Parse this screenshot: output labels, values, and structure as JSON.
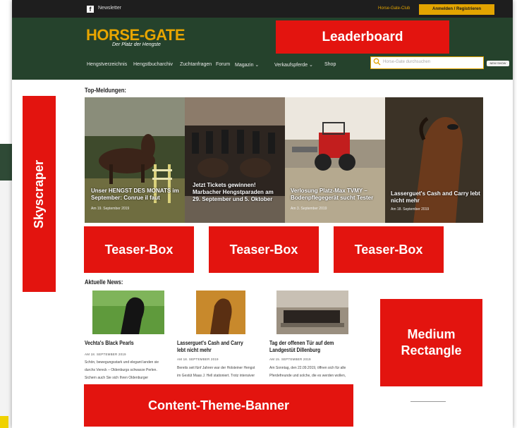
{
  "site": {
    "topbar": {
      "newsletter": "Newsletter",
      "club": "Horse-Gate-Club",
      "login": "Anmelden / Registrieren"
    },
    "logo": "HORSE-GATE",
    "tagline": "Der Platz der Hengste",
    "nav": [
      "Hengstverzeichnis",
      "Hengstbucharchiv",
      "Zuchtanfragen",
      "Forum",
      "Magazin ⌄",
      "Verkaufspferde ⌄",
      "Shop"
    ],
    "search_placeholder": "Horse-Gate durchsuchen",
    "search_button": "NEW SHOW"
  },
  "top_meldungen": {
    "heading": "Top-Meldungen:",
    "teasers": [
      {
        "title": "Unser HENGST DES MONATS im September: Conrue il faut",
        "date": "Am 19. September 2019"
      },
      {
        "title": "Jetzt Tickets gewinnen! Marbacher Hengstparaden am 29. September und 5. Oktober",
        "date": ""
      },
      {
        "title": "Verlosung Platz-Max TVMY – Bodenpflegegerät sucht Tester",
        "date": "Am 3. September 2019"
      },
      {
        "title": "Lasserguet's Cash and Carry lebt nicht mehr",
        "date": "Am 18. September 2019"
      }
    ]
  },
  "aktuelle_news": {
    "heading": "Aktuelle News:",
    "items": [
      {
        "title": "Vechta's Black Pearls",
        "date": "AM 18. SEPTEMBER 2019",
        "text": [
          "Schön, bewegungsstark und elegant landen sie",
          "durchs Vereck – Oldenburgs schwarze Perlen.",
          "Sichern auch Sie sich Ihren Oldenburger"
        ]
      },
      {
        "title": "Lasserguet's Cash and Carry lebt nicht mehr",
        "date": "AM 18. SEPTEMBER 2019",
        "text": [
          "Bereits seit fünf Jahren war der Holsteiner Hengst",
          "im Gestüt Maas J. Hell stationiert. Trotz intensiver"
        ]
      },
      {
        "title": "Tag der offenen Tür auf dem Landgestüt Dillenburg",
        "date": "AM 15. SEPTEMBER 2019",
        "text": [
          "Am Sonntag, den 22.09.2019, öffnen sich für alle",
          "Pferdefreunde und solche, die es werden wollen,"
        ]
      }
    ]
  },
  "ads": {
    "leaderboard": "Leaderboard",
    "skyscraper": "Skyscraper",
    "teaser_box": "Teaser-Box",
    "medium_rectangle_line1": "Medium",
    "medium_rectangle_line2": "Rectangle",
    "content_banner": "Content-Theme-Banner"
  },
  "colors": {
    "ad_red": "#e3140f",
    "header_green": "#25422c",
    "brand_gold": "#e3a400",
    "topbar": "#1e1e1e"
  }
}
